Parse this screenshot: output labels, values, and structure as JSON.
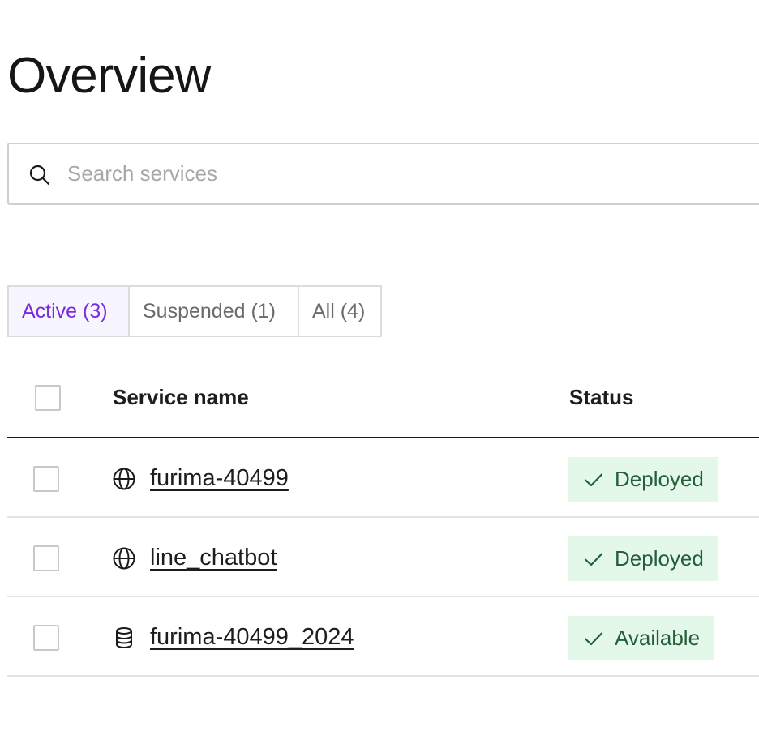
{
  "page": {
    "title": "Overview"
  },
  "search": {
    "placeholder": "Search services",
    "value": ""
  },
  "tabs": [
    {
      "label": "Active (3)",
      "active": true
    },
    {
      "label": "Suspended (1)",
      "active": false
    },
    {
      "label": "All (4)",
      "active": false
    }
  ],
  "table": {
    "columns": {
      "name": "Service name",
      "status": "Status"
    },
    "rows": [
      {
        "name": "furima-40499",
        "icon": "globe-icon",
        "status": "Deployed"
      },
      {
        "name": "line_chatbot",
        "icon": "globe-icon",
        "status": "Deployed"
      },
      {
        "name": "furima-40499_2024",
        "icon": "database-icon",
        "status": "Available"
      }
    ]
  },
  "colors": {
    "accent": "#7a2ae0",
    "active_tab_bg": "#f7f5fe",
    "status_bg": "#e4f8ea",
    "status_text": "#245e3a"
  }
}
